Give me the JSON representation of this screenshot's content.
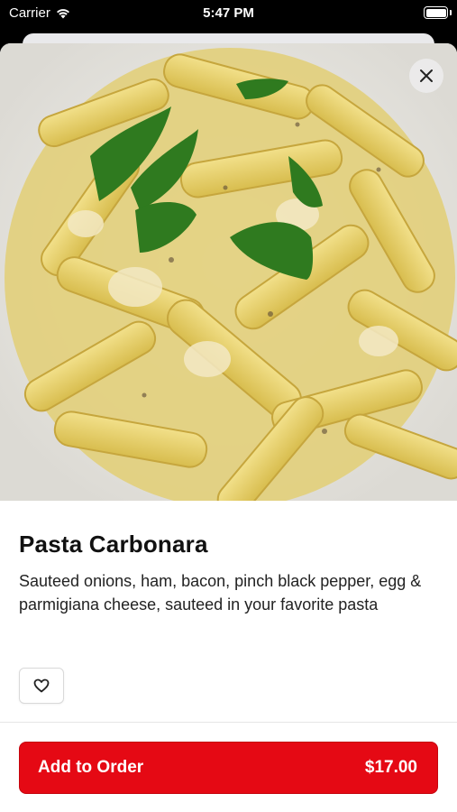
{
  "status_bar": {
    "carrier": "Carrier",
    "time": "5:47 PM",
    "wifi_icon": "wifi-icon",
    "battery_icon": "battery-icon"
  },
  "item": {
    "image_alt_icon": "pasta-dish-photo",
    "close_icon": "close-icon",
    "name": "Pasta Carbonara",
    "description": "Sauteed onions, ham, bacon, pinch black pepper, egg & parmigiana cheese, sauteed in your favorite pasta",
    "favorite_icon": "heart-icon"
  },
  "order_button": {
    "label": "Add to Order",
    "price": "$17.00"
  },
  "colors": {
    "accent": "#e50914",
    "background": "#ffffff",
    "text": "#111111"
  }
}
